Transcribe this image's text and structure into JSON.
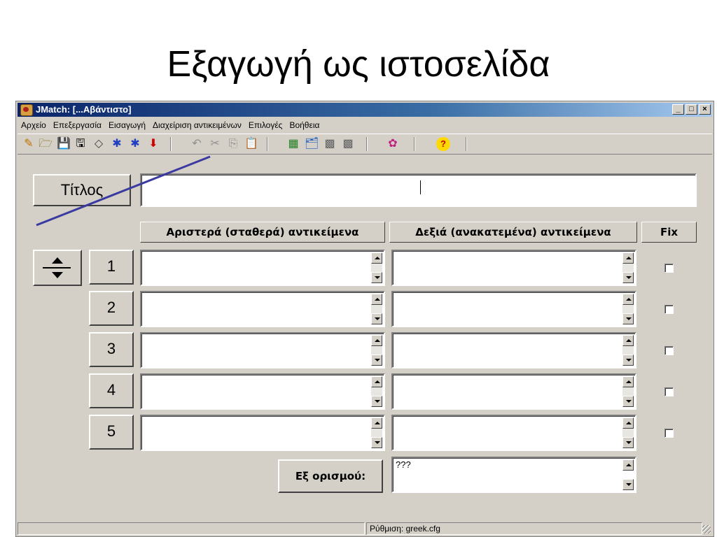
{
  "slide": {
    "title": "Εξαγωγή ως ιστοσελίδα"
  },
  "window": {
    "title": "JMatch: [...Αβάντιστο]",
    "controls": {
      "minimize": "_",
      "maximize": "□",
      "close": "×"
    }
  },
  "menu": [
    "Αρχείο",
    "Επεξεργασία",
    "Εισαγωγή",
    "Διαχείριση αντικειμένων",
    "Επιλογές",
    "Βοήθεια"
  ],
  "toolbar": {
    "icons": [
      "new-icon",
      "open-icon",
      "save-icon",
      "save-as-icon",
      "eraser-icon",
      "export-web-v6-icon",
      "export-web-v6-alt-icon",
      "download-icon",
      "undo-icon",
      "cut-icon",
      "copy-icon",
      "paste-icon",
      "image-icon",
      "folder-web-icon",
      "puzzle-icon",
      "puzzle-alt-icon",
      "config-icon",
      "help-icon"
    ],
    "glyphs": [
      "✎",
      "🗁",
      "💾",
      "🖫",
      "◇",
      "✱",
      "✱",
      "⬇",
      "↶",
      "✂",
      "⎘",
      "📋",
      "▦",
      "🗂",
      "▩",
      "▩",
      "✿",
      "?"
    ]
  },
  "title_button": {
    "label": "Τίτλος"
  },
  "title_field": {
    "value": ""
  },
  "headers": {
    "left": "Αριστερά (σταθερά) αντικείμενα",
    "right": "Δεξιά (ανακατεμένα) αντικείμενα",
    "fix": "Fix"
  },
  "rows": [
    {
      "num": "1",
      "left": "",
      "right": "",
      "fixed": false
    },
    {
      "num": "2",
      "left": "",
      "right": "",
      "fixed": false
    },
    {
      "num": "3",
      "left": "",
      "right": "",
      "fixed": false
    },
    {
      "num": "4",
      "left": "",
      "right": "",
      "fixed": false
    },
    {
      "num": "5",
      "left": "",
      "right": "",
      "fixed": false
    }
  ],
  "default": {
    "label": "Εξ ορισμού:",
    "value": "???"
  },
  "statusbar": {
    "config": "Ρύθμιση: greek.cfg"
  },
  "colors": {
    "titlebar": "#0a246a",
    "face": "#d4d0c8",
    "annotation": "#3a3aa0"
  }
}
